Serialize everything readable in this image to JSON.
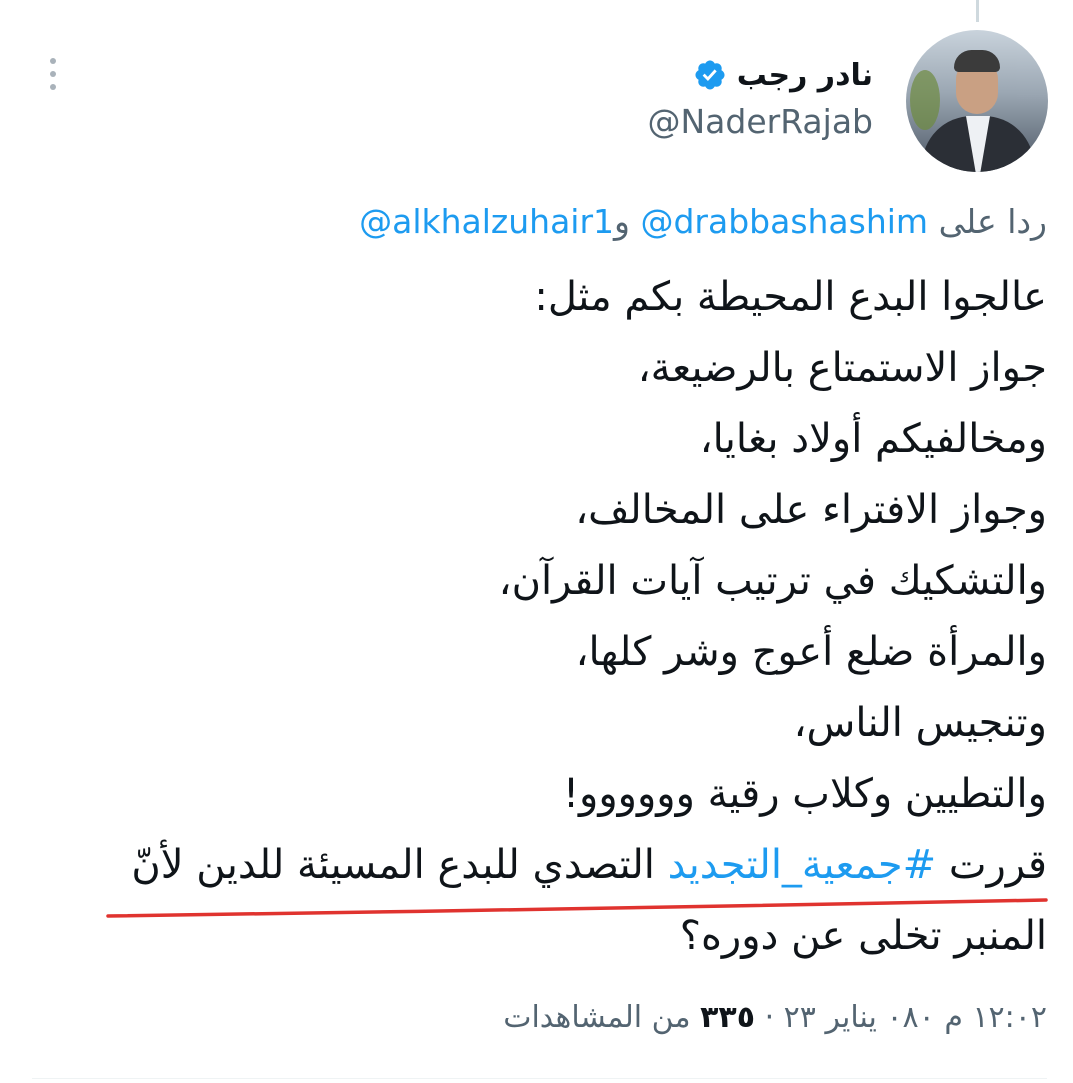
{
  "author": {
    "name": "نادر رجب",
    "handle": "@NaderRajab",
    "verified": true
  },
  "reply": {
    "prefix": "ردا على",
    "mention_1": "@drabbashashim",
    "conjunction": "و",
    "mention_2": "@alkhalzuhair1"
  },
  "tweet": {
    "lines": [
      "عالجوا البدع المحيطة بكم مثل:",
      "جواز الاستمتاع بالرضيعة،",
      "ومخالفيكم أولاد بغايا،",
      "وجواز الافتراء على المخالف،",
      "والتشكيك في ترتيب آيات القرآن،",
      "والمرأة ضلع أعوج وشر كلها،",
      "وتنجيس الناس،",
      "والتطيين وكلاب رقية وووووو!"
    ],
    "highlight_prefix": "قررت ",
    "hashtag": "#جمعية_التجديد",
    "highlight_suffix": " التصدي للبدع المسيئة للدين لأنّ",
    "last_line": "المنبر تخلى عن دوره؟"
  },
  "meta": {
    "time_date": "١٢:٠٢ م ٠٨٠ يناير ٢٣",
    "separator": "·",
    "views_count": "٣٣٥",
    "views_label": "من المشاهدات"
  },
  "colors": {
    "link": "#1d9bf0",
    "secondary_text": "#536471",
    "underline_annotation": "#e0332f"
  }
}
